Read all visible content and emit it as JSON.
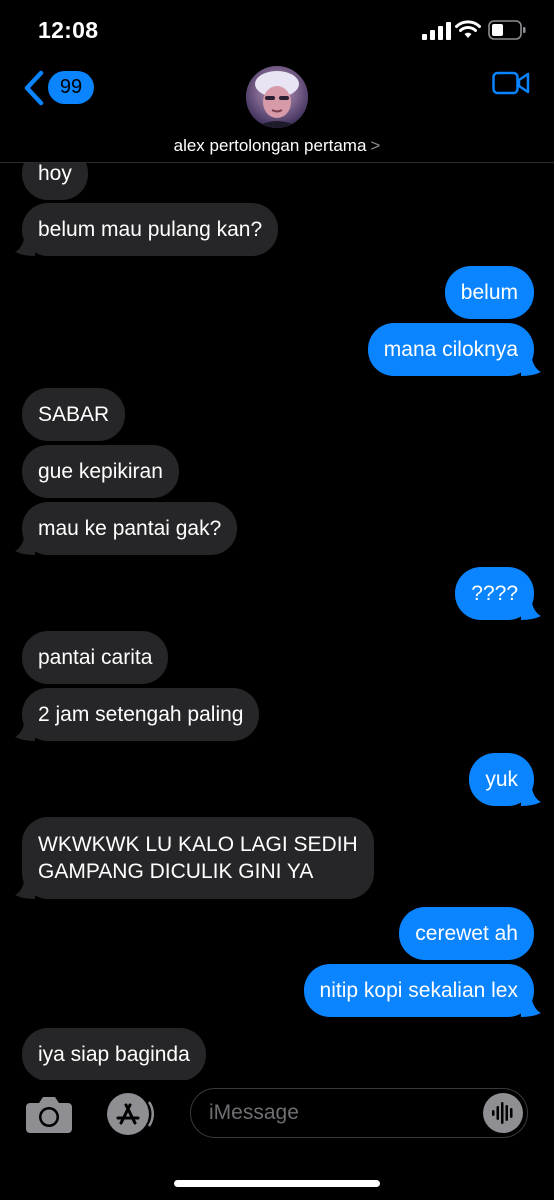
{
  "status_bar": {
    "time": "12:08"
  },
  "header": {
    "back_badge": "99",
    "contact_name": "alex pertolongan pertama",
    "chevron": ">"
  },
  "messages": [
    {
      "side": "received",
      "text": "hoy"
    },
    {
      "side": "received",
      "text": "belum mau pulang kan?"
    },
    {
      "side": "sent",
      "text": "belum"
    },
    {
      "side": "sent",
      "text": "mana ciloknya"
    },
    {
      "side": "received",
      "text": "SABAR"
    },
    {
      "side": "received",
      "text": "gue kepikiran"
    },
    {
      "side": "received",
      "text": "mau ke pantai gak?"
    },
    {
      "side": "sent",
      "text": "????"
    },
    {
      "side": "received",
      "text": "pantai carita"
    },
    {
      "side": "received",
      "text": "2 jam setengah paling"
    },
    {
      "side": "sent",
      "text": "yuk"
    },
    {
      "side": "received",
      "text_line1": "WKWKWK LU KALO LAGI SEDIH",
      "text_line2": "GAMPANG DICULIK GINI YA"
    },
    {
      "side": "sent",
      "text": "cerewet ah"
    },
    {
      "side": "sent",
      "text": "nitip kopi sekalian lex"
    },
    {
      "side": "received",
      "text": "iya siap baginda"
    }
  ],
  "input_bar": {
    "placeholder": "iMessage"
  },
  "colors": {
    "sent_bubble": "#0a84ff",
    "received_bubble": "#262628",
    "background": "#000000"
  }
}
